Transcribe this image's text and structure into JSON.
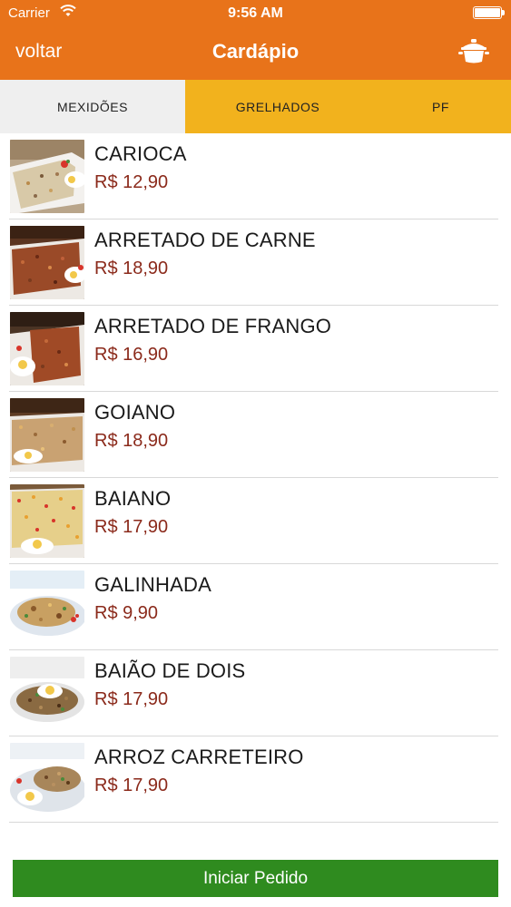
{
  "status_bar": {
    "carrier": "Carrier",
    "time": "9:56 AM"
  },
  "nav": {
    "back_label": "voltar",
    "title": "Cardápio",
    "cart_icon": "pot-icon"
  },
  "tabs": [
    {
      "label": "MEXIDÕES",
      "active": true
    },
    {
      "label": "GRELHADOS",
      "active": false
    },
    {
      "label": "PF",
      "active": false
    }
  ],
  "menu": {
    "items": [
      {
        "name": "CARIOCA",
        "price": "R$ 12,90",
        "image": "rice-dish-photo"
      },
      {
        "name": "ARRETADO DE CARNE",
        "price": "R$ 18,90",
        "image": "rice-dish-photo"
      },
      {
        "name": "ARRETADO DE FRANGO",
        "price": "R$ 16,90",
        "image": "rice-dish-photo"
      },
      {
        "name": "GOIANO",
        "price": "R$ 18,90",
        "image": "rice-dish-photo"
      },
      {
        "name": "BAIANO",
        "price": "R$ 17,90",
        "image": "rice-dish-photo"
      },
      {
        "name": "GALINHADA",
        "price": "R$ 9,90",
        "image": "rice-dish-photo"
      },
      {
        "name": "BAIÃO DE DOIS",
        "price": "R$ 17,90",
        "image": "rice-dish-photo"
      },
      {
        "name": "ARROZ CARRETEIRO",
        "price": "R$ 17,90",
        "image": "rice-dish-photo"
      }
    ]
  },
  "footer": {
    "order_button_label": "Iniciar Pedido"
  },
  "colors": {
    "header": "#E8731A",
    "tabs": "#F2B21D",
    "active_tab": "#EFEFEF",
    "price": "#8B2A1B",
    "order_button": "#2F8B1F"
  }
}
